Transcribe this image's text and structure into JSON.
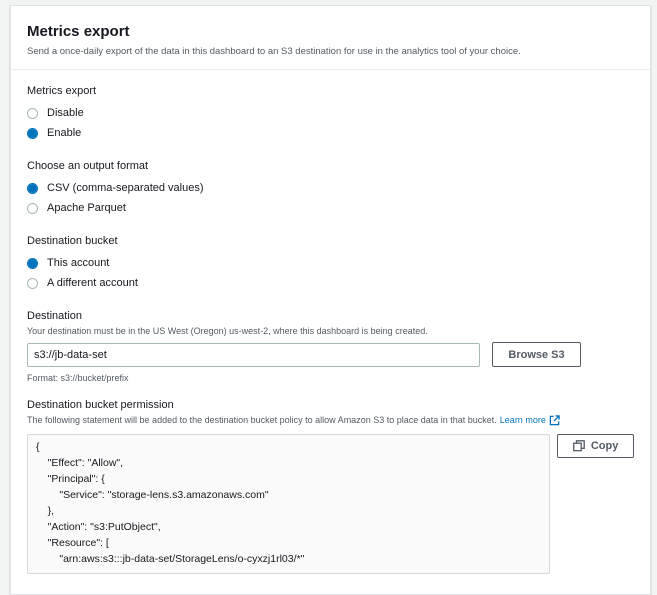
{
  "header": {
    "title": "Metrics export",
    "subtitle": "Send a once-daily export of the data in this dashboard to an S3 destination for use in the analytics tool of your choice."
  },
  "metrics_export": {
    "label": "Metrics export",
    "options": [
      {
        "label": "Disable",
        "selected": false
      },
      {
        "label": "Enable",
        "selected": true
      }
    ]
  },
  "output_format": {
    "label": "Choose an output format",
    "options": [
      {
        "label": "CSV (comma-separated values)",
        "selected": true
      },
      {
        "label": "Apache Parquet",
        "selected": false
      }
    ]
  },
  "destination_bucket": {
    "label": "Destination bucket",
    "options": [
      {
        "label": "This account",
        "selected": true
      },
      {
        "label": "A different account",
        "selected": false
      }
    ]
  },
  "destination": {
    "label": "Destination",
    "description": "Your destination must be in the US West (Oregon) us-west-2, where this dashboard is being created.",
    "value": "s3://jb-data-set",
    "browse_label": "Browse S3",
    "format_hint": "Format: s3://bucket/prefix"
  },
  "permission": {
    "label": "Destination bucket permission",
    "description": "The following statement will be added to the destination bucket policy to allow Amazon S3 to place data in that bucket.",
    "learn_more": "Learn more",
    "copy_label": "Copy",
    "code_lines": [
      "{",
      "    \"Effect\": \"Allow\",",
      "    \"Principal\": {",
      "        \"Service\": \"storage-lens.s3.amazonaws.com\"",
      "    },",
      "    \"Action\": \"s3:PutObject\",",
      "    \"Resource\": [",
      "        \"arn:aws:s3:::jb-data-set/StorageLens/o-cyxzj1rl03/*\""
    ]
  },
  "colors": {
    "accent": "#0073bb",
    "text": "#16191f",
    "secondary_text": "#545b64",
    "border": "#aab7b8"
  }
}
